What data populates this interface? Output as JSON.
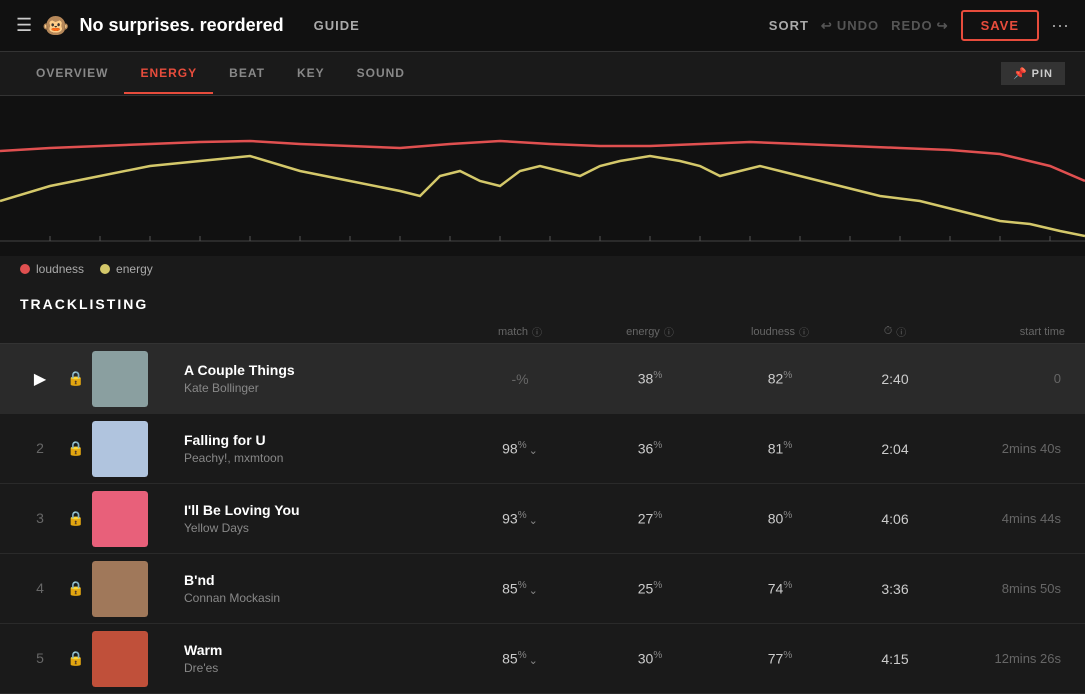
{
  "header": {
    "menu_icon": "☰",
    "monkey_icon": "🐵",
    "title": "No surprises. reordered",
    "guide_label": "GUIDE",
    "sort_label": "SORT",
    "undo_label": "UNDO",
    "redo_label": "REDO",
    "save_label": "SAVE",
    "more_icon": "···"
  },
  "tabs": [
    {
      "label": "OVERVIEW",
      "active": false
    },
    {
      "label": "ENERGY",
      "active": true
    },
    {
      "label": "BEAT",
      "active": false
    },
    {
      "label": "KEY",
      "active": false
    },
    {
      "label": "SOUND",
      "active": false
    }
  ],
  "pin_label": "PIN",
  "chart": {
    "legend": [
      {
        "label": "loudness",
        "type": "loudness"
      },
      {
        "label": "energy",
        "type": "energy"
      }
    ]
  },
  "tracklisting": {
    "heading": "TRACKLISTING",
    "columns": {
      "match": "match",
      "energy": "energy",
      "loudness": "loudness",
      "duration": "⏱",
      "start_time": "start time"
    },
    "tracks": [
      {
        "num": "",
        "is_playing": true,
        "locked": true,
        "title": "A Couple Things",
        "artist": "Kate Bollinger",
        "match": "-%",
        "match_arrow": false,
        "energy": "38",
        "loudness": "82",
        "duration": "2:40",
        "start_time": "0",
        "thumb_color": "#8a9fa0",
        "thumb_char": "🎵"
      },
      {
        "num": "2",
        "is_playing": false,
        "locked": true,
        "title": "Falling for U",
        "artist": "Peachy!, mxmtoon",
        "match": "98",
        "match_arrow": true,
        "energy": "36",
        "loudness": "81",
        "duration": "2:04",
        "start_time": "2mins 40s",
        "thumb_color": "#b0c4de",
        "thumb_char": "🎵"
      },
      {
        "num": "3",
        "is_playing": false,
        "locked": true,
        "title": "I'll Be Loving You",
        "artist": "Yellow Days",
        "match": "93",
        "match_arrow": true,
        "energy": "27",
        "loudness": "80",
        "duration": "4:06",
        "start_time": "4mins 44s",
        "thumb_color": "#e8607a",
        "thumb_char": "🎵"
      },
      {
        "num": "4",
        "is_playing": false,
        "locked": true,
        "title": "B'nd",
        "artist": "Connan Mockasin",
        "match": "85",
        "match_arrow": true,
        "energy": "25",
        "loudness": "74",
        "duration": "3:36",
        "start_time": "8mins 50s",
        "thumb_color": "#a0785a",
        "thumb_char": "🎵"
      },
      {
        "num": "5",
        "is_playing": false,
        "locked": true,
        "title": "Warm",
        "artist": "Dre'es",
        "match": "85",
        "match_arrow": true,
        "energy": "30",
        "loudness": "77",
        "duration": "4:15",
        "start_time": "12mins 26s",
        "thumb_color": "#c0503a",
        "thumb_char": "🎵"
      }
    ]
  }
}
